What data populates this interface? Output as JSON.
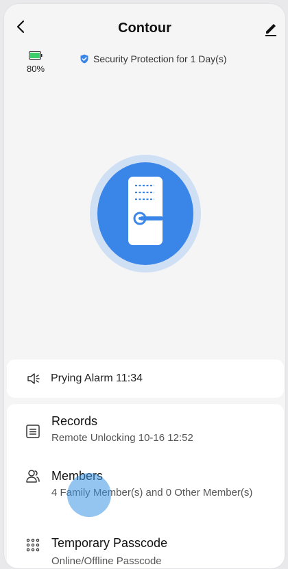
{
  "header": {
    "title": "Contour"
  },
  "status": {
    "battery": "80%",
    "security_text": "Security Protection for 1 Day(s)"
  },
  "alarm": {
    "text": "Prying Alarm 11:34"
  },
  "list": {
    "records": {
      "title": "Records",
      "subtitle": "Remote Unlocking 10-16 12:52"
    },
    "members": {
      "title": "Members",
      "subtitle": "4 Family Member(s) and 0 Other Member(s)"
    },
    "passcode": {
      "title": "Temporary Passcode",
      "subtitle": "Online/Offline Passcode"
    }
  },
  "icons": {
    "back": "back-arrow-icon",
    "edit": "pencil-icon",
    "battery": "battery-icon",
    "shield": "shield-check-icon",
    "lock": "door-lock-icon",
    "alarm": "speaker-alarm-icon",
    "records": "list-icon",
    "members": "members-icon",
    "passcode": "keypad-grid-icon"
  },
  "colors": {
    "accent": "#3a86e8",
    "battery_green": "#3ccf6a",
    "shield_blue": "#3a86e8",
    "ring": "#cfe0f5"
  }
}
